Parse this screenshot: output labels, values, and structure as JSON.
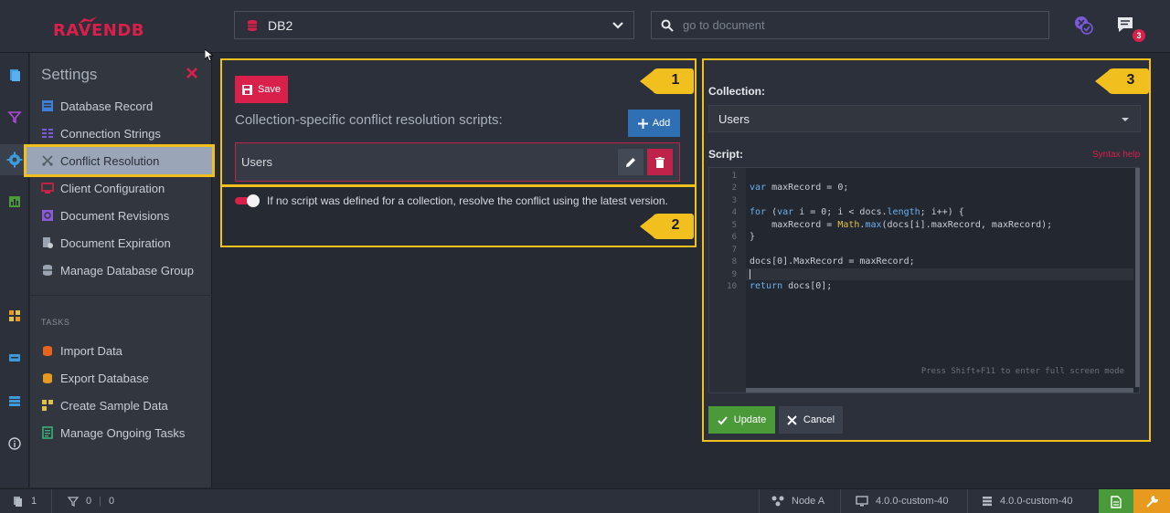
{
  "app": {
    "logo_text": "RAVENDB"
  },
  "header": {
    "database": "DB2",
    "search_placeholder": "go to document",
    "notifications_count": "3"
  },
  "menu": {
    "title": "Settings",
    "items": [
      {
        "label": "Database Record",
        "icon": "database-record-icon",
        "color": "#3d7fd9"
      },
      {
        "label": "Connection Strings",
        "icon": "connection-strings-icon",
        "color": "#7a5ad9"
      },
      {
        "label": "Conflict Resolution",
        "icon": "conflict-icon",
        "color": "#555c66",
        "active": true
      },
      {
        "label": "Client Configuration",
        "icon": "client-config-icon",
        "color": "#d9204a"
      },
      {
        "label": "Document Revisions",
        "icon": "revisions-icon",
        "color": "#8a5ad9"
      },
      {
        "label": "Document Expiration",
        "icon": "expiration-icon",
        "color": "#9aa3b0"
      },
      {
        "label": "Manage Database Group",
        "icon": "db-group-icon",
        "color": "#9aa3b0"
      }
    ],
    "tasks_heading": "TASKS",
    "tasks": [
      {
        "label": "Import Data",
        "icon": "import-icon",
        "color": "#e8641e"
      },
      {
        "label": "Export Database",
        "icon": "export-icon",
        "color": "#e89a1e"
      },
      {
        "label": "Create Sample Data",
        "icon": "sample-data-icon",
        "color": "#e0c24a"
      },
      {
        "label": "Manage Ongoing Tasks",
        "icon": "ongoing-tasks-icon",
        "color": "#3ab07a"
      }
    ]
  },
  "callouts": [
    "1",
    "2",
    "3"
  ],
  "conflict_panel": {
    "save_label": "Save",
    "heading": "Collection-specific conflict resolution scripts:",
    "add_label": "Add",
    "collection_row": "Users",
    "toggle_label": "If no script was defined for a collection, resolve the conflict using the latest version.",
    "toggle_on": true
  },
  "editor_panel": {
    "collection_label": "Collection:",
    "collection_value": "Users",
    "script_label": "Script:",
    "syntax_help": "Syntax help",
    "code_lines": [
      "",
      "var maxRecord = 0;",
      "",
      "for (var i = 0; i < docs.length; i++) {",
      "    maxRecord = Math.max(docs[i].maxRecord, maxRecord);",
      "}",
      "",
      "docs[0].MaxRecord = maxRecord;",
      "",
      "return docs[0];"
    ],
    "line_numbers": [
      "1",
      "2",
      "3",
      "4",
      "5",
      "6",
      "7",
      "8",
      "9",
      "10"
    ],
    "fullscreen_hint": "Press Shift+F11 to enter full screen mode",
    "update_label": "Update",
    "cancel_label": "Cancel"
  },
  "statusbar": {
    "docs_count": "1",
    "indexes_count": "0",
    "indexes_errors": "0",
    "node": "Node A",
    "client_version": "4.0.0-custom-40",
    "server_version": "4.0.0-custom-40"
  },
  "colors": {
    "accent": "#d9204a",
    "highlight": "#f2c01e",
    "primary": "#2f6fb3",
    "success": "#4a9a3a"
  }
}
